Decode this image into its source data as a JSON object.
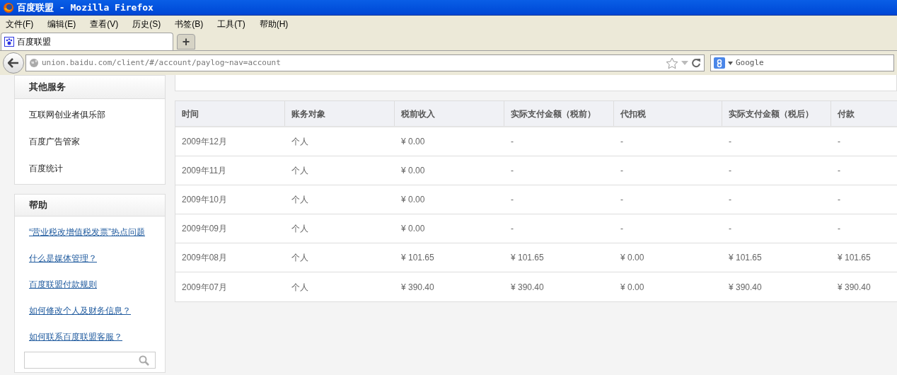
{
  "window": {
    "title": "百度联盟 - Mozilla Firefox"
  },
  "menu": [
    "文件(F)",
    "编辑(E)",
    "查看(V)",
    "历史(S)",
    "书签(B)",
    "工具(T)",
    "帮助(H)"
  ],
  "tabs": [
    {
      "label": "百度联盟",
      "selected": true
    }
  ],
  "new_tab": "+",
  "address": {
    "value": "union.baidu.com/client/#/account/paylog~nav=account"
  },
  "search": {
    "placeholder": "Google"
  },
  "sidebar": [
    {
      "title": "其他服务",
      "items": [
        {
          "label": "互联网创业者俱乐部",
          "kind": "plain"
        },
        {
          "label": "百度广告管家",
          "kind": "plain"
        },
        {
          "label": "百度统计",
          "kind": "plain"
        }
      ]
    },
    {
      "title": "帮助",
      "items": [
        {
          "label": "“营业税改增值税发票”热点问题",
          "kind": "link"
        },
        {
          "label": "什么是媒体管理？",
          "kind": "link"
        },
        {
          "label": "百度联盟付款规则",
          "kind": "link"
        },
        {
          "label": "如何修改个人及财务信息？",
          "kind": "link"
        },
        {
          "label": "如何联系百度联盟客服？",
          "kind": "link"
        }
      ],
      "search": true
    }
  ],
  "table": {
    "columns": [
      "时间",
      "账务对象",
      "税前收入",
      "实际支付金额（税前）",
      "代扣税",
      "实际支付金额（税后）",
      "付款"
    ],
    "rows": [
      [
        "2009年12月",
        "个人",
        "¥ 0.00",
        "-",
        "-",
        "-",
        "-"
      ],
      [
        "2009年11月",
        "个人",
        "¥ 0.00",
        "-",
        "-",
        "-",
        "-"
      ],
      [
        "2009年10月",
        "个人",
        "¥ 0.00",
        "-",
        "-",
        "-",
        "-"
      ],
      [
        "2009年09月",
        "个人",
        "¥ 0.00",
        "-",
        "-",
        "-",
        "-"
      ],
      [
        "2009年08月",
        "个人",
        "¥ 101.65",
        "¥ 101.65",
        "¥ 0.00",
        "¥ 101.65",
        "¥ 101.65"
      ],
      [
        "2009年07月",
        "个人",
        "¥ 390.40",
        "¥ 390.40",
        "¥ 0.00",
        "¥ 390.40",
        "¥ 390.40"
      ]
    ]
  }
}
